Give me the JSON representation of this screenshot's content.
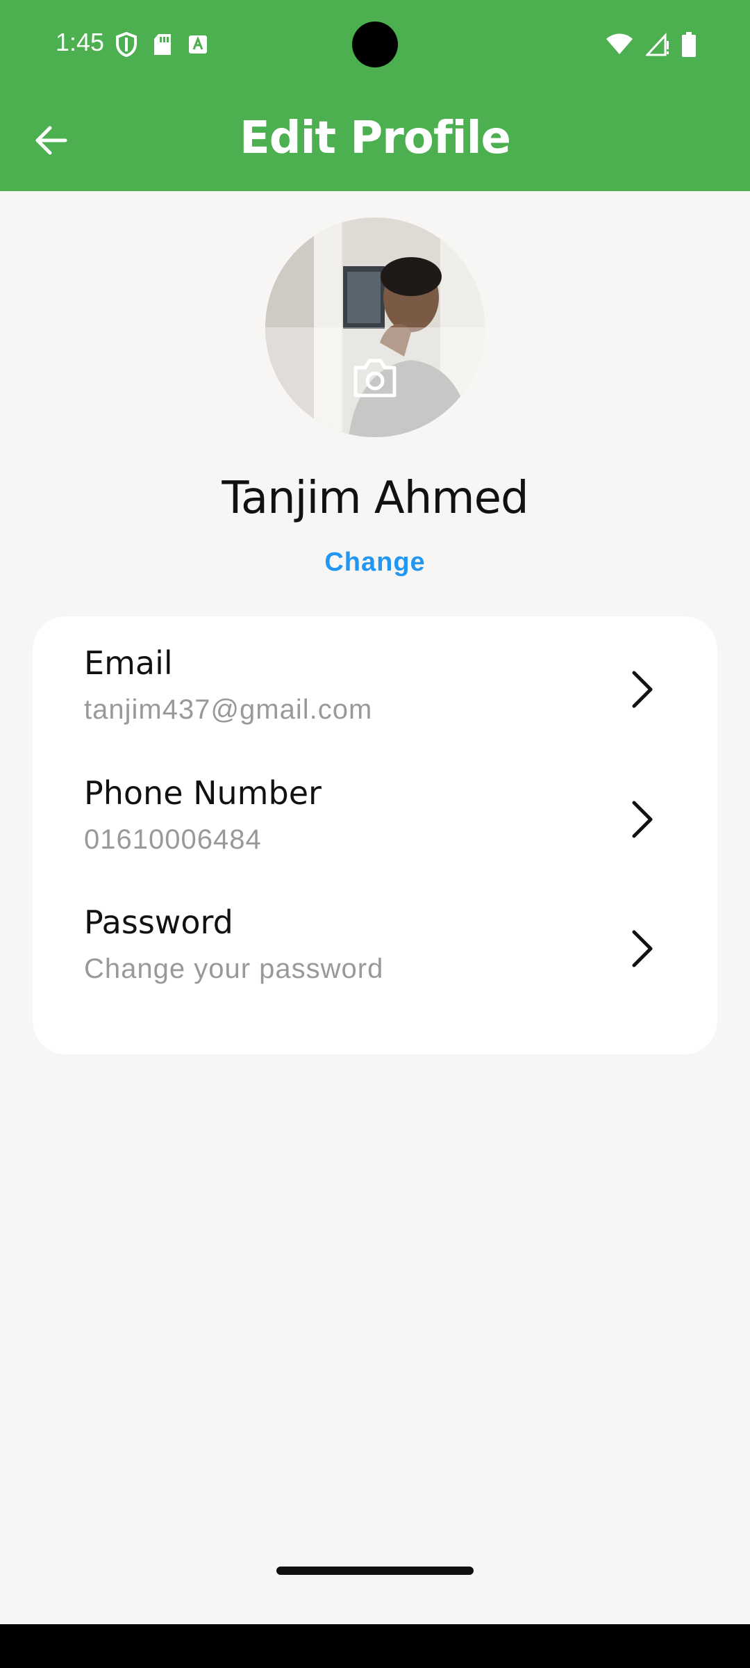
{
  "status_bar": {
    "time": "1:45"
  },
  "app_bar": {
    "title": "Edit Profile",
    "back_icon": "arrow-left-icon"
  },
  "profile": {
    "name": "Tanjim Ahmed",
    "change_label": "Change",
    "camera_icon": "camera-icon"
  },
  "settings": [
    {
      "title": "Email",
      "value": "tanjim437@gmail.com"
    },
    {
      "title": "Phone Number",
      "value": "01610006484"
    },
    {
      "title": "Password",
      "value": "Change your password"
    }
  ],
  "colors": {
    "primary": "#4caf50",
    "link": "#2196f3",
    "background": "#f7f6f4",
    "card": "#ffffff"
  }
}
